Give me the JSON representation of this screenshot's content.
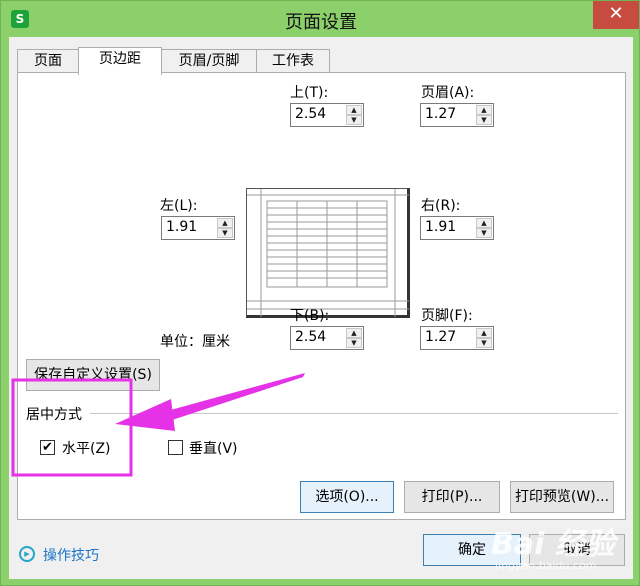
{
  "window": {
    "title": "页面设置",
    "app_icon": "S",
    "close_glyph": "✕"
  },
  "tabs": [
    {
      "label": "页面"
    },
    {
      "label": "页边距"
    },
    {
      "label": "页眉/页脚"
    },
    {
      "label": "工作表"
    }
  ],
  "margins": {
    "top": {
      "label": "上(T):",
      "value": "2.54"
    },
    "header": {
      "label": "页眉(A):",
      "value": "1.27"
    },
    "left": {
      "label": "左(L):",
      "value": "1.91"
    },
    "right": {
      "label": "右(R):",
      "value": "1.91"
    },
    "bottom": {
      "label": "下(B):",
      "value": "2.54"
    },
    "footer": {
      "label": "页脚(F):",
      "value": "1.27"
    },
    "unit": "单位：厘米"
  },
  "save_custom_button": "保存自定义设置(S)",
  "center": {
    "group_label": "居中方式",
    "horizontal": {
      "label": "水平(Z)",
      "checked": true,
      "mark": "✔"
    },
    "vertical": {
      "label": "垂直(V)",
      "checked": false
    }
  },
  "action_buttons": {
    "options": "选项(O)...",
    "print": "打印(P)...",
    "print_preview": "打印预览(W)..."
  },
  "footer": {
    "tips": "操作技巧",
    "tips_icon": "▶",
    "ok": "确定",
    "cancel": "取消"
  },
  "watermark": {
    "main": "Bai 经验",
    "sub": "jingyan.baidu.com"
  },
  "colors": {
    "title_bar": "#8bd06a",
    "close": "#c74b3f",
    "annotation": "#e632e6",
    "link": "#1a73c6"
  }
}
